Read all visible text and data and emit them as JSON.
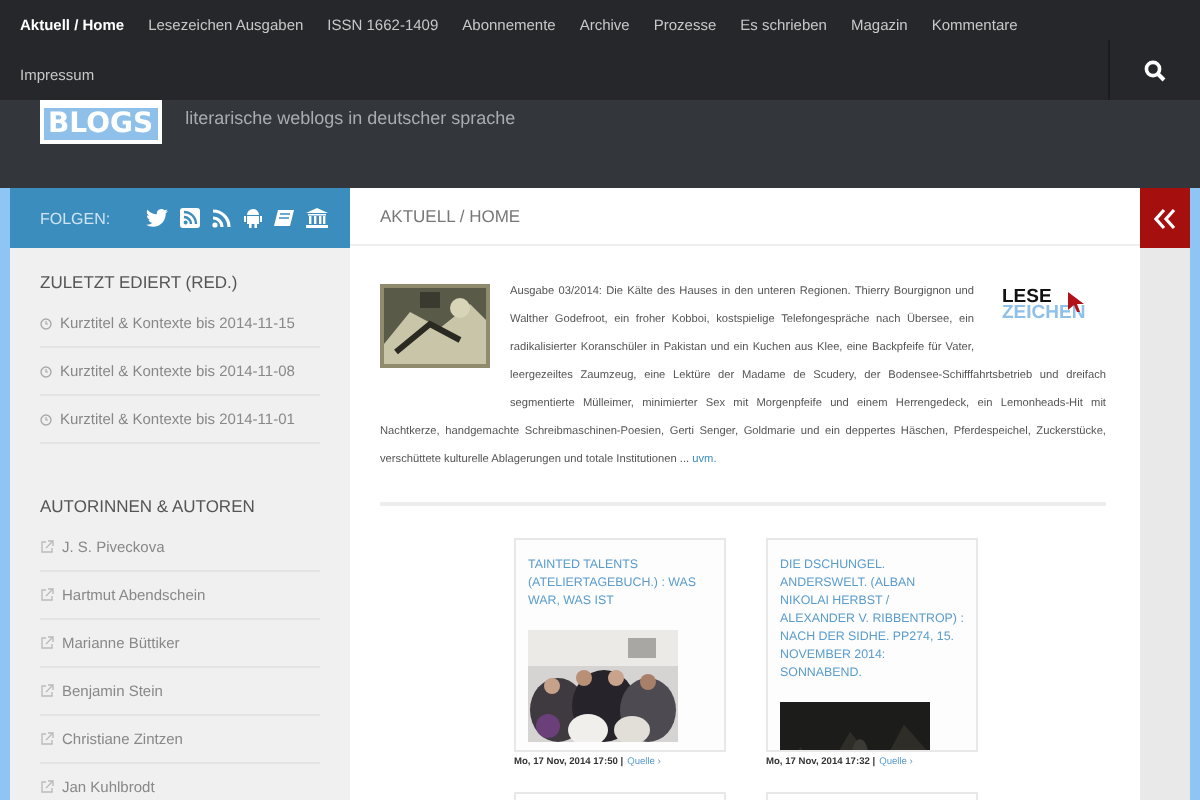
{
  "nav": {
    "items": [
      {
        "label": "Aktuell / Home",
        "selected": true
      },
      {
        "label": "Lesezeichen Ausgaben",
        "selected": false
      },
      {
        "label": "ISSN 1662-1409",
        "selected": false
      },
      {
        "label": "Abonnemente",
        "selected": false
      },
      {
        "label": "Archive",
        "selected": false
      },
      {
        "label": "Prozesse",
        "selected": false
      },
      {
        "label": "Es schrieben",
        "selected": false
      },
      {
        "label": "Magazin",
        "selected": false
      },
      {
        "label": "Kommentare",
        "selected": false
      },
      {
        "label": "Impressum",
        "selected": false
      }
    ]
  },
  "header": {
    "logo_text": "BLOGS",
    "tagline": "literarische weblogs in deutscher sprache"
  },
  "sidebar": {
    "follow_label": "FOLGEN:",
    "sections": [
      {
        "title": "ZULETZT EDIERT (RED.)",
        "kind": "recent",
        "items": [
          "Kurztitel & Kontexte bis 2014-11-15",
          "Kurztitel & Kontexte bis 2014-11-08",
          "Kurztitel & Kontexte bis 2014-11-01"
        ]
      },
      {
        "title": "AUTORINNEN & AUTOREN",
        "kind": "links",
        "items": [
          "J. S. Piveckova",
          "Hartmut Abendschein",
          "Marianne Büttiker",
          "Benjamin Stein",
          "Christiane Zintzen",
          "Jan Kuhlbrodt"
        ]
      }
    ]
  },
  "breadcrumb": "AKTUELL / HOME",
  "post": {
    "text_parts": [
      "Ausgabe 03/2014: Die Kälte des Hauses in den unteren Regionen. Thierry Bourgignon und Walther Godefroot, ein froher Kobboi, kostspielige Telefongespräche nach Übersee, ein radikalisierter Koranschüler in Pakistan und ein Kuchen aus Klee, eine Backpfeife für Vater,",
      "leergezeiltes Zaumzeug, eine Lektüre der Madame de Scudery, der Bodensee-Schifffahrtsbetrieb und dreifach segmentierte Mülleimer, minimierter Sex mit Morgenpfeife und einem Herrengedeck, ein Lemonheads-Hit mit",
      "Nachtkerze, handgemachte Schreibmaschinen-Poesien, Gerti Senger, Goldmarie und ein deppertes Häschen, Pferdespeichel, Zuckerstücke, verschüttete kulturelle Ablagerungen und totale Institutionen ..."
    ],
    "more": "uvm.",
    "logo_top": "LESE",
    "logo_bottom": "ZEICHEN"
  },
  "cards": [
    {
      "title": "TAINTED TALENTS (ATELIERTAGEBUCH.) : WAS WAR, WAS IST",
      "meta": "Mo, 17 Nov, 2014 17:50 |",
      "source": "Quelle ›"
    },
    {
      "title": "DIE DSCHUNGEL. ANDERSWELT. (ALBAN NIKOLAI HERBST / ALEXANDER V. RIBBENTROP) : NACH DER SIDHE. PP274, 15. NOVEMBER 2014: SONNABEND.",
      "meta": "Mo, 17 Nov, 2014 17:32 |",
      "source": "Quelle ›"
    }
  ]
}
